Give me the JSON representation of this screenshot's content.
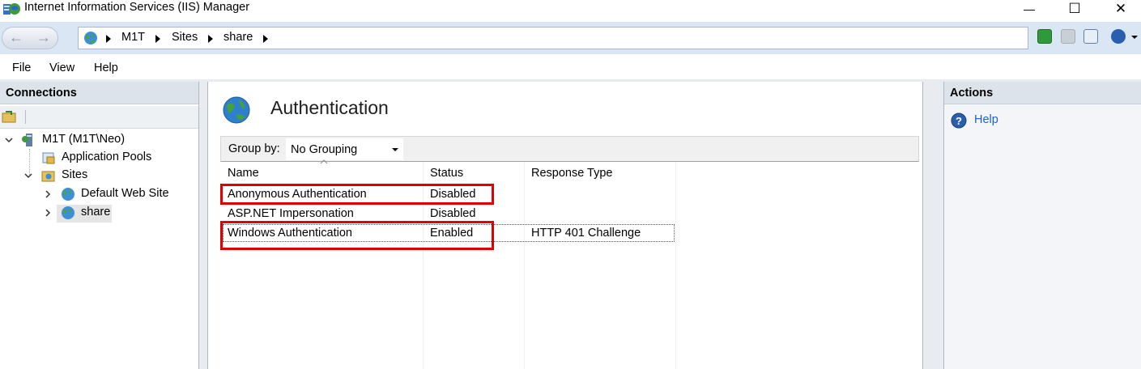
{
  "window": {
    "title": "Internet Information Services (IIS) Manager",
    "min_glyph": "—",
    "max_glyph": "☐",
    "close_glyph": "✕"
  },
  "address": {
    "breadcrumbs": [
      "M1T",
      "Sites",
      "share"
    ],
    "toolbar_icons": [
      "refresh-icon",
      "stop-icon",
      "home-icon",
      "help-icon"
    ]
  },
  "menu": [
    "File",
    "View",
    "Help"
  ],
  "connections": {
    "title": "Connections",
    "tree": [
      {
        "label": "M1T (M1T\\Neo)",
        "icon": "server-icon"
      },
      {
        "label": "Application Pools",
        "icon": "app-pools-icon"
      },
      {
        "label": "Sites",
        "icon": "sites-folder-icon"
      },
      {
        "label": "Default Web Site",
        "icon": "globe-icon"
      },
      {
        "label": "share",
        "icon": "globe-icon",
        "selected": true
      }
    ]
  },
  "feature": {
    "title": "Authentication",
    "group_by_label": "Group by:",
    "group_by_value": "No Grouping",
    "columns": [
      "Name",
      "Status",
      "Response Type"
    ],
    "rows": [
      {
        "name": "Anonymous Authentication",
        "status": "Disabled",
        "response": ""
      },
      {
        "name": "ASP.NET Impersonation",
        "status": "Disabled",
        "response": ""
      },
      {
        "name": "Windows Authentication",
        "status": "Enabled",
        "response": "HTTP 401 Challenge"
      }
    ]
  },
  "actions": {
    "title": "Actions",
    "items": [
      "Help"
    ]
  },
  "colors": {
    "highlight": "#e00000",
    "link": "#1a63c7",
    "address_bg": "#dbe6f4"
  }
}
